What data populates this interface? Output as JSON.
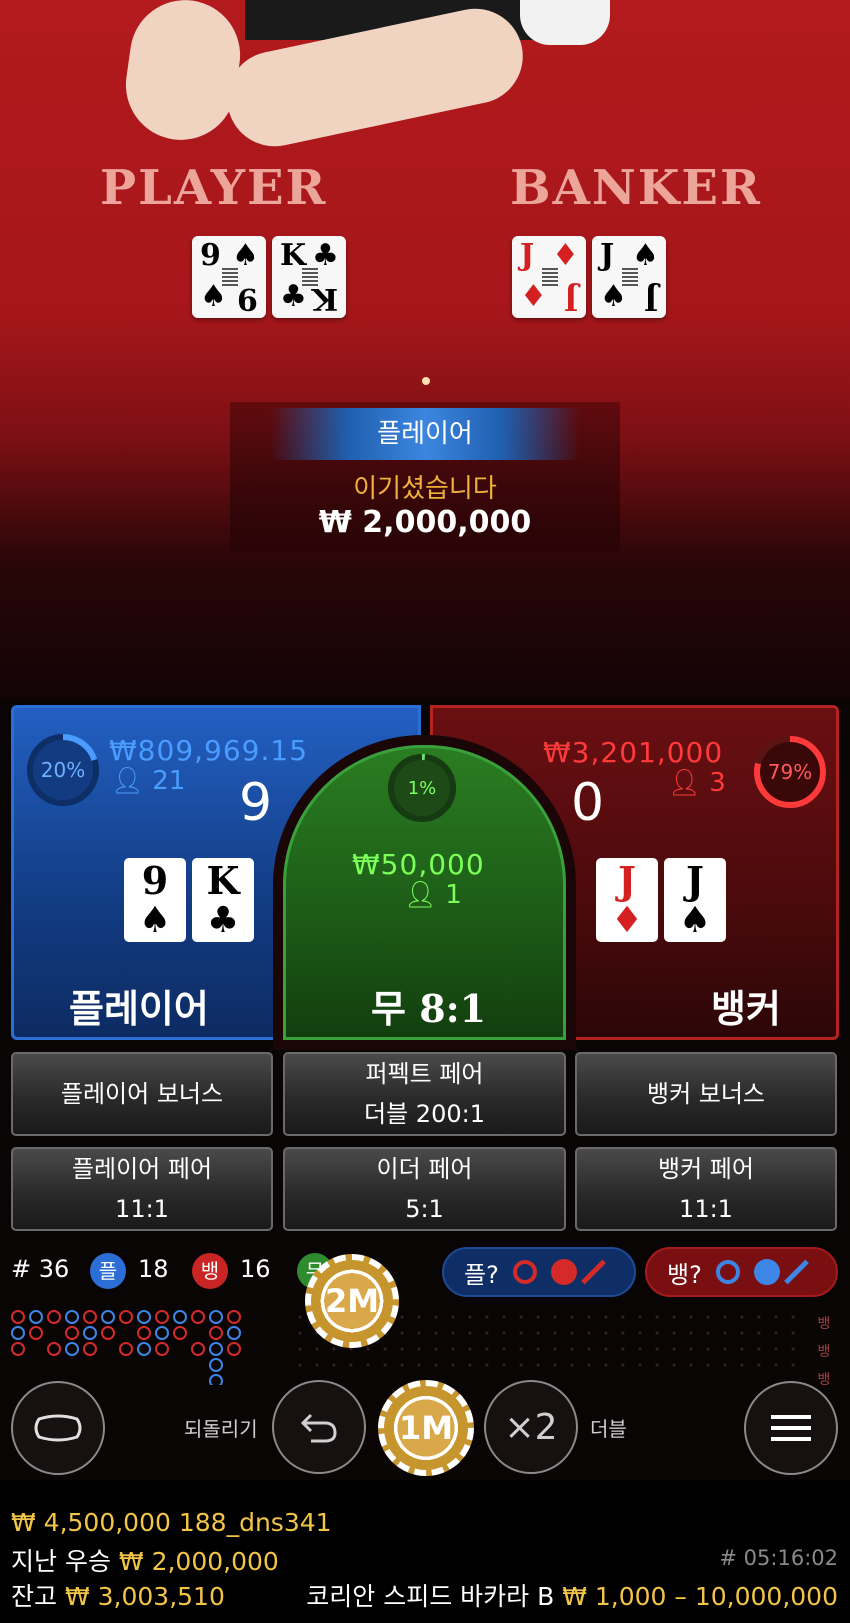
{
  "video": {
    "player_label": "PLAYER",
    "banker_label": "BANKER",
    "player_cards": [
      {
        "rank": "9",
        "suit": "♠",
        "color": "#000000"
      },
      {
        "rank": "K",
        "suit": "♣",
        "color": "#000000"
      }
    ],
    "banker_cards": [
      {
        "rank": "J",
        "suit": "♦",
        "color": "#d42020"
      },
      {
        "rank": "J",
        "suit": "♠",
        "color": "#000000"
      }
    ],
    "result_side": "플레이어",
    "result_message": "이기셨습니다",
    "result_amount": "₩ 2,000,000"
  },
  "player_spot": {
    "percent": "20%",
    "percent_value": 0.2,
    "amount": "₩809,969.15",
    "players": "21",
    "score": "9",
    "cards": [
      {
        "rank": "9",
        "suit": "♠"
      },
      {
        "rank": "K",
        "suit": "♣"
      }
    ],
    "label": "플레이어"
  },
  "tie_spot": {
    "percent": "1%",
    "percent_value": 0.01,
    "amount": "₩50,000",
    "players": "1",
    "label": "무",
    "odds": "8:1"
  },
  "banker_spot": {
    "percent": "79%",
    "percent_value": 0.79,
    "amount": "₩3,201,000",
    "players": "3",
    "score": "0",
    "cards": [
      {
        "rank": "J",
        "suit": "♦"
      },
      {
        "rank": "J",
        "suit": "♠"
      }
    ],
    "label": "뱅커"
  },
  "side_bets": {
    "player_bonus": "플레이어 보너스",
    "perfect_pair": "퍼펙트 페어",
    "perfect_pair_odds": "더블 200:1",
    "banker_bonus": "뱅커 보너스",
    "player_pair": "플레이어 페어",
    "player_pair_odds": "11:1",
    "either_pair": "이더 페어",
    "either_pair_odds": "5:1",
    "banker_pair": "뱅커 페어",
    "banker_pair_odds": "11:1"
  },
  "stats": {
    "round": "# 36",
    "player_badge": "플",
    "player_count": "18",
    "banker_badge": "뱅",
    "banker_count": "16",
    "tie_badge": "무",
    "player_predict": "플?",
    "banker_predict": "뱅?"
  },
  "roadmap": {
    "side_labels": [
      "뱅",
      "뱅",
      "뱅"
    ]
  },
  "controls": {
    "chip_top": "2M",
    "chip_main": "1M",
    "undo_label": "되돌리기",
    "double_label": "더블",
    "double_icon": "×2"
  },
  "footer": {
    "bet_total": "₩ 4,500,000",
    "username": "188_dns341",
    "last_win_label": "지난 우승",
    "last_win_amount": "₩ 2,000,000",
    "game_id": "# 05:16:02",
    "balance_label": "잔고",
    "balance_amount": "₩ 3,003,510",
    "table_name": "코리안 스피드 바카라 B",
    "limits": "₩ 1,000 – 10,000,000"
  },
  "colors": {
    "player": "#2b6fd6",
    "banker": "#d42a2a",
    "tie": "#3aa13a",
    "gold": "#f2c447"
  }
}
